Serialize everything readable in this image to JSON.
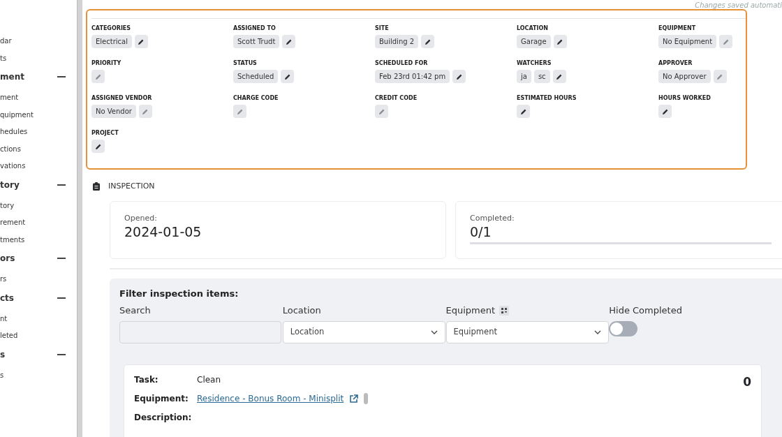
{
  "sidebar": {
    "items": [
      {
        "kind": "link",
        "label": "dar"
      },
      {
        "kind": "link",
        "label": "ts"
      },
      {
        "kind": "heading",
        "label": "ment",
        "expanded": true
      },
      {
        "kind": "link",
        "label": "ment"
      },
      {
        "kind": "link",
        "label": "quipment"
      },
      {
        "kind": "link",
        "label": "hedules"
      },
      {
        "kind": "link",
        "label": "ctions"
      },
      {
        "kind": "link",
        "label": "vations"
      },
      {
        "kind": "heading",
        "label": "tory",
        "expanded": true
      },
      {
        "kind": "link",
        "label": "tory"
      },
      {
        "kind": "link",
        "label": "rement"
      },
      {
        "kind": "link",
        "label": "tments"
      },
      {
        "kind": "heading",
        "label": "ors",
        "expanded": true
      },
      {
        "kind": "link",
        "label": "rs"
      },
      {
        "kind": "heading",
        "label": "cts",
        "expanded": true
      },
      {
        "kind": "link",
        "label": "nt"
      },
      {
        "kind": "link",
        "label": "leted"
      },
      {
        "kind": "heading",
        "label": "s",
        "expanded": true
      },
      {
        "kind": "link",
        "label": "s"
      }
    ]
  },
  "save_note": "Changes saved automati",
  "details": {
    "fields": [
      {
        "label": "CATEGORIES",
        "values": [
          "Electrical"
        ],
        "dimmed": false
      },
      {
        "label": "ASSIGNED TO",
        "values": [
          "Scott Trudt"
        ],
        "dimmed": false
      },
      {
        "label": "SITE",
        "values": [
          "Building 2"
        ],
        "dimmed": false
      },
      {
        "label": "LOCATION",
        "values": [
          "Garage"
        ],
        "dimmed": false
      },
      {
        "label": "EQUIPMENT",
        "values": [
          "No Equipment"
        ],
        "dimmed": true
      },
      {
        "label": "PRIORITY",
        "dimmed": true
      },
      {
        "label": "STATUS",
        "values": [
          "Scheduled"
        ],
        "dimmed": false
      },
      {
        "label": "SCHEDULED FOR",
        "values": [
          "Feb 23rd 01:42 pm"
        ],
        "dimmed": false
      },
      {
        "label": "WATCHERS",
        "values": [
          "ja",
          "sc"
        ],
        "dimmed": false
      },
      {
        "label": "APPROVER",
        "values": [
          "No Approver"
        ],
        "dimmed": true
      },
      {
        "label": "ASSIGNED VENDOR",
        "values": [
          "No Vendor"
        ],
        "dimmed": true
      },
      {
        "label": "CHARGE CODE",
        "dimmed": true
      },
      {
        "label": "CREDIT CODE",
        "dimmed": true
      },
      {
        "label": "ESTIMATED HOURS",
        "dimmed": false
      },
      {
        "label": "HOURS WORKED",
        "dimmed": false
      },
      {
        "label": "PROJECT",
        "dimmed": false
      }
    ]
  },
  "inspection": {
    "title": "INSPECTION",
    "stats": [
      {
        "label": "Opened:",
        "value": "2024-01-05"
      },
      {
        "label": "Completed:",
        "value": "0/1",
        "level": 0
      }
    ],
    "filter": {
      "title": "Filter inspection items:",
      "fields": [
        {
          "kind": "text",
          "label": "Search"
        },
        {
          "kind": "select",
          "label": "Location",
          "placeholder": "Location"
        },
        {
          "kind": "select",
          "label": "Equipment",
          "placeholder": "Equipment",
          "scan": true
        },
        {
          "kind": "toggle",
          "label": "Hide Completed",
          "on": false
        }
      ]
    },
    "items": [
      {
        "count": "0",
        "rows": [
          {
            "kind": "text",
            "label": "Task:",
            "value": "Clean"
          },
          {
            "kind": "link",
            "label": "Equipment:",
            "value": "Residence - Bonus Room - Minisplit"
          },
          {
            "kind": "text",
            "label": "Description:"
          }
        ]
      }
    ]
  }
}
